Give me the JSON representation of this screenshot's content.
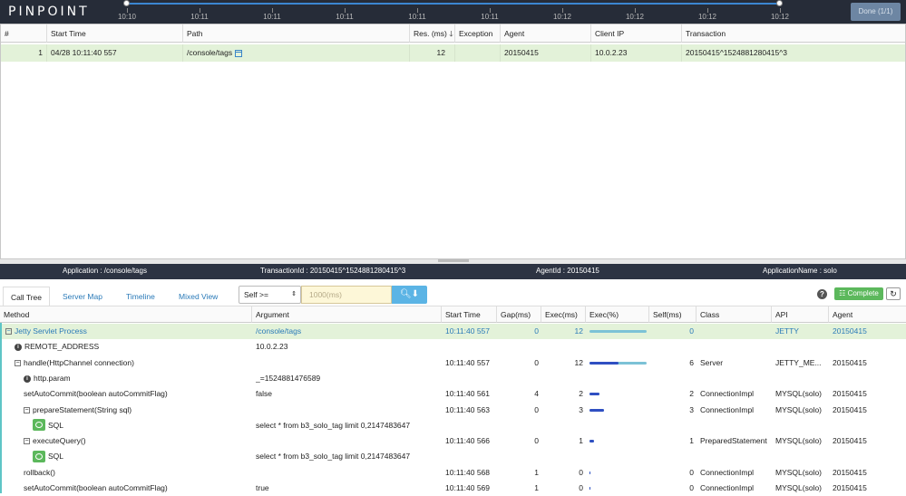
{
  "header": {
    "logo": "PINPOINT",
    "timeline_labels": [
      "10:10",
      "10:11",
      "10:11",
      "10:11",
      "10:11",
      "10:11",
      "10:12",
      "10:12",
      "10:12",
      "10:12"
    ],
    "done_label": "Done (1/1)"
  },
  "tx_table": {
    "columns": [
      "#",
      "Start Time",
      "Path",
      "Res. (ms)",
      "Exception",
      "Agent",
      "Client IP",
      "Transaction"
    ],
    "sort_arrow": "🡓",
    "rows": [
      {
        "num": "1",
        "start": "04/28 10:11:40 557",
        "path": "/console/tags",
        "res": "12",
        "exception": "",
        "agent": "20150415",
        "client_ip": "10.0.2.23",
        "transaction": "20150415^1524881280415^3"
      }
    ]
  },
  "infobar": {
    "application": "Application : /console/tags",
    "transaction_id": "TransactionId : 20150415^1524881280415^3",
    "agent_id": "AgentId : 20150415",
    "application_name": "ApplicationName : solo"
  },
  "tabs": {
    "call_tree": "Call Tree",
    "server_map": "Server Map",
    "timeline": "Timeline",
    "mixed_view": "Mixed View",
    "self_select": "Self >=",
    "ms_placeholder": "1000(ms)",
    "complete": "Complete"
  },
  "calltree": {
    "columns": [
      "Method",
      "Argument",
      "Start Time",
      "Gap(ms)",
      "Exec(ms)",
      "Exec(%)",
      "Self(ms)",
      "Class",
      "API",
      "Agent"
    ],
    "rows": [
      {
        "indent": 0,
        "toggle": "−",
        "icon": "",
        "method": "Jetty Servlet Process",
        "argument": "/console/tags",
        "start": "10:11:40 557",
        "gap": "0",
        "exec": "12",
        "pct": 1.0,
        "self_pct": 0,
        "self": "0",
        "class": "",
        "api": "JETTY",
        "agent": "20150415",
        "selected": true
      },
      {
        "indent": 1,
        "toggle": "",
        "icon": "info",
        "method": "REMOTE_ADDRESS",
        "argument": "10.0.2.23",
        "start": "",
        "gap": "",
        "exec": "",
        "pct": 0,
        "self_pct": 0,
        "self": "",
        "class": "",
        "api": "",
        "agent": "",
        "selected": false
      },
      {
        "indent": 1,
        "toggle": "−",
        "icon": "",
        "method": "handle(HttpChannel connection)",
        "argument": "",
        "start": "10:11:40 557",
        "gap": "0",
        "exec": "12",
        "pct": 1.0,
        "self_pct": 0.5,
        "self": "6",
        "class": "Server",
        "api": "JETTY_ME...",
        "agent": "20150415",
        "selected": false
      },
      {
        "indent": 2,
        "toggle": "",
        "icon": "info",
        "method": "http.param",
        "argument": "_=1524881476589",
        "start": "",
        "gap": "",
        "exec": "",
        "pct": 0,
        "self_pct": 0,
        "self": "",
        "class": "",
        "api": "",
        "agent": "",
        "selected": false
      },
      {
        "indent": 2,
        "toggle": "",
        "icon": "",
        "method": "setAutoCommit(boolean autoCommitFlag)",
        "argument": "false",
        "start": "10:11:40 561",
        "gap": "4",
        "exec": "2",
        "pct": 0.17,
        "self_pct": 0.17,
        "self": "2",
        "class": "ConnectionImpl",
        "api": "MYSQL(solo)",
        "agent": "20150415",
        "selected": false
      },
      {
        "indent": 2,
        "toggle": "−",
        "icon": "",
        "method": "prepareStatement(String sql)",
        "argument": "",
        "start": "10:11:40 563",
        "gap": "0",
        "exec": "3",
        "pct": 0.25,
        "self_pct": 0.25,
        "self": "3",
        "class": "ConnectionImpl",
        "api": "MYSQL(solo)",
        "agent": "20150415",
        "selected": false
      },
      {
        "indent": 3,
        "toggle": "",
        "icon": "sql",
        "method": "SQL",
        "argument": "select * from b3_solo_tag limit 0,2147483647",
        "start": "",
        "gap": "",
        "exec": "",
        "pct": 0,
        "self_pct": 0,
        "self": "",
        "class": "",
        "api": "",
        "agent": "",
        "selected": false
      },
      {
        "indent": 2,
        "toggle": "−",
        "icon": "",
        "method": "executeQuery()",
        "argument": "",
        "start": "10:11:40 566",
        "gap": "0",
        "exec": "1",
        "pct": 0.08,
        "self_pct": 0.08,
        "self": "1",
        "class": "PreparedStatement",
        "api": "MYSQL(solo)",
        "agent": "20150415",
        "selected": false
      },
      {
        "indent": 3,
        "toggle": "",
        "icon": "sql",
        "method": "SQL",
        "argument": "select * from b3_solo_tag limit 0,2147483647",
        "start": "",
        "gap": "",
        "exec": "",
        "pct": 0,
        "self_pct": 0,
        "self": "",
        "class": "",
        "api": "",
        "agent": "",
        "selected": false
      },
      {
        "indent": 2,
        "toggle": "",
        "icon": "",
        "method": "rollback()",
        "argument": "",
        "start": "10:11:40 568",
        "gap": "1",
        "exec": "0",
        "pct": 0.005,
        "self_pct": 0.005,
        "self": "0",
        "class": "ConnectionImpl",
        "api": "MYSQL(solo)",
        "agent": "20150415",
        "selected": false
      },
      {
        "indent": 2,
        "toggle": "",
        "icon": "",
        "method": "setAutoCommit(boolean autoCommitFlag)",
        "argument": "true",
        "start": "10:11:40 569",
        "gap": "1",
        "exec": "0",
        "pct": 0.005,
        "self_pct": 0.005,
        "self": "0",
        "class": "ConnectionImpl",
        "api": "MYSQL(solo)",
        "agent": "20150415",
        "selected": false
      }
    ]
  },
  "colors": {
    "accent": "#2a7ab8",
    "selected_row": "#e3f2d9",
    "bar_total": "#7cc2d6",
    "bar_self": "#2f4fc2"
  }
}
